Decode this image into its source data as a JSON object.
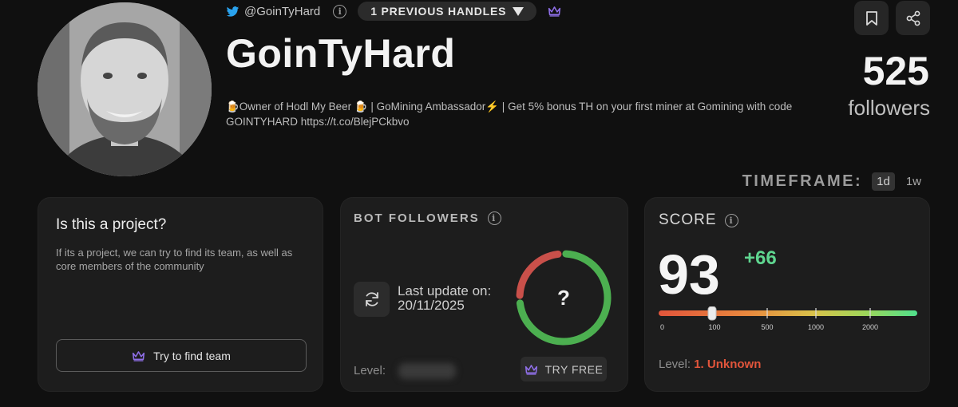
{
  "profile": {
    "handle": "@GoinTyHard",
    "previous_handles": "1 PREVIOUS HANDLES",
    "name": "GoinTyHard",
    "bio": "🍺Owner of Hodl My Beer 🍺 | GoMining Ambassador⚡ | Get 5% bonus TH on your first miner at Gomining with code GOINTYHARD https://t.co/BlejPCkbvo",
    "followers_count": "525",
    "followers_label": "followers"
  },
  "icons": {
    "twitter": "twitter-bird-icon",
    "info": "info-icon",
    "crown": "crown-icon",
    "bookmark": "bookmark-icon",
    "share": "share-icon",
    "refresh": "refresh-icon"
  },
  "timeframe": {
    "label": "TIMEFRAME:",
    "options": [
      "1d",
      "1w"
    ],
    "selected": "1d"
  },
  "project_card": {
    "title": "Is this a project?",
    "description": "If its a project, we can try to find its team, as well as core members of the community",
    "button_label": "Try to find team"
  },
  "bot_card": {
    "title": "BOT FOLLOWERS",
    "update_label": "Last update on:",
    "update_date": "20/11/2025",
    "ring_center": "?",
    "level_label": "Level:",
    "try_free_label": "TRY FREE",
    "ring_red_fraction": 0.25
  },
  "score_card": {
    "title": "SCORE",
    "value": "93",
    "delta": "+66",
    "ticks": [
      "0",
      "100",
      "500",
      "1000",
      "2000"
    ],
    "level_label": "Level:",
    "level_value": "1. Unknown"
  },
  "colors": {
    "background": "#101010",
    "card": "#1d1d1d",
    "delta_green": "#5fd690",
    "level_red": "#e2553b",
    "ring_red": "#c9504a",
    "ring_green": "#4caf50",
    "crown_purple": "#8f6fe8"
  }
}
